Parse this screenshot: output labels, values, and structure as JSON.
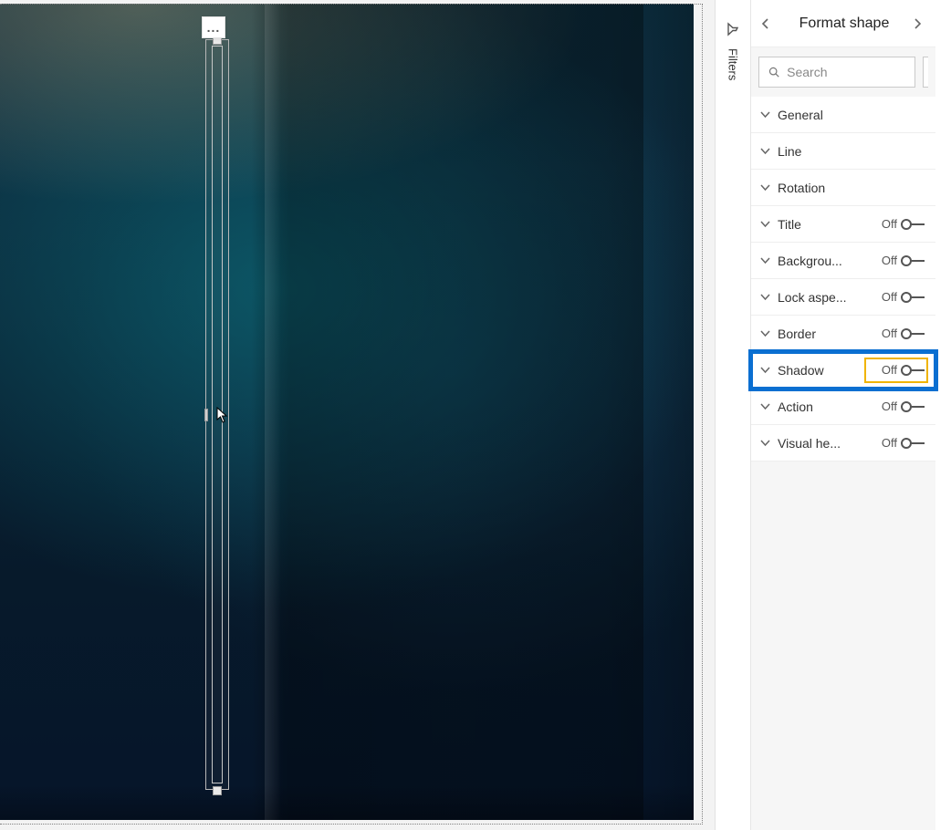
{
  "pane": {
    "title": "Format shape",
    "back_aria": "Back",
    "next_aria": "Next"
  },
  "search": {
    "placeholder": "Search"
  },
  "filters_rail": {
    "label": "Filters"
  },
  "more_options": "...",
  "properties": [
    {
      "id": "general",
      "label": "General",
      "has_toggle": false
    },
    {
      "id": "line",
      "label": "Line",
      "has_toggle": false
    },
    {
      "id": "rotation",
      "label": "Rotation",
      "has_toggle": false
    },
    {
      "id": "title",
      "label": "Title",
      "has_toggle": true,
      "toggle_state": "Off"
    },
    {
      "id": "background",
      "label": "Backgrou...",
      "has_toggle": true,
      "toggle_state": "Off"
    },
    {
      "id": "lock_aspect",
      "label": "Lock aspe...",
      "has_toggle": true,
      "toggle_state": "Off"
    },
    {
      "id": "border",
      "label": "Border",
      "has_toggle": true,
      "toggle_state": "Off"
    },
    {
      "id": "shadow",
      "label": "Shadow",
      "has_toggle": true,
      "toggle_state": "Off",
      "highlighted": true
    },
    {
      "id": "action",
      "label": "Action",
      "has_toggle": true,
      "toggle_state": "Off"
    },
    {
      "id": "visual_header",
      "label": "Visual he...",
      "has_toggle": true,
      "toggle_state": "Off"
    }
  ]
}
